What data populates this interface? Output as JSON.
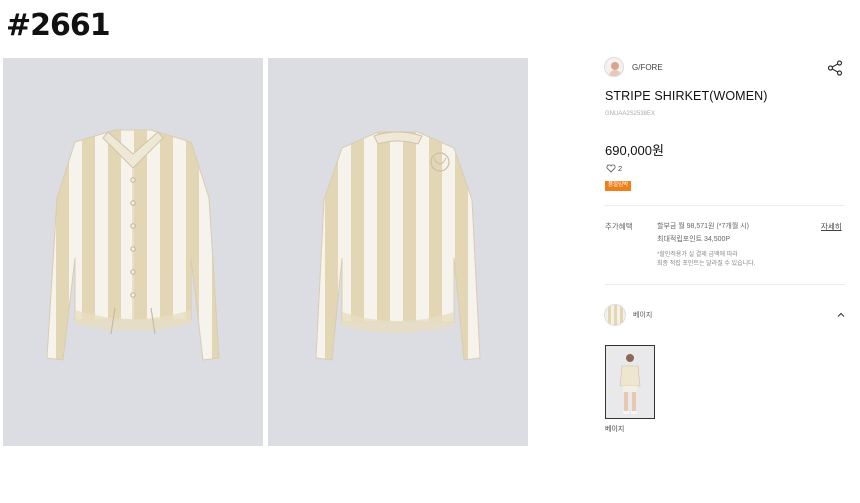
{
  "tag": "#2661",
  "brand": {
    "name": "G/FORE",
    "logo_icon": "brand-avatar-icon"
  },
  "share_icon": "share-icon",
  "product": {
    "title": "STRIPE SHIRKET(WOMEN)",
    "code": "GNUAA2S2538EX",
    "price": "690,000원",
    "likes": "2",
    "badge": "품절임박"
  },
  "benefits": {
    "label": "추가혜택",
    "lines": [
      "할부금 월 98,571원 (*7개월 시)",
      "최대적립포인트 34,500P",
      "*할인적용가 실 결제 금액에 따라",
      "최종 적립 포인트는 달라질 수 있습니다."
    ],
    "detail_link": "자세히"
  },
  "color_option": {
    "label": "베이지",
    "icon": "chevron-up-icon"
  },
  "variants": [
    {
      "label": "베이지"
    }
  ],
  "colors": {
    "accent": "#f07f1a",
    "photo_bg": "#dcdde2",
    "stripe_beige": "#e2d6b4",
    "stripe_white": "#f6f3ec"
  }
}
